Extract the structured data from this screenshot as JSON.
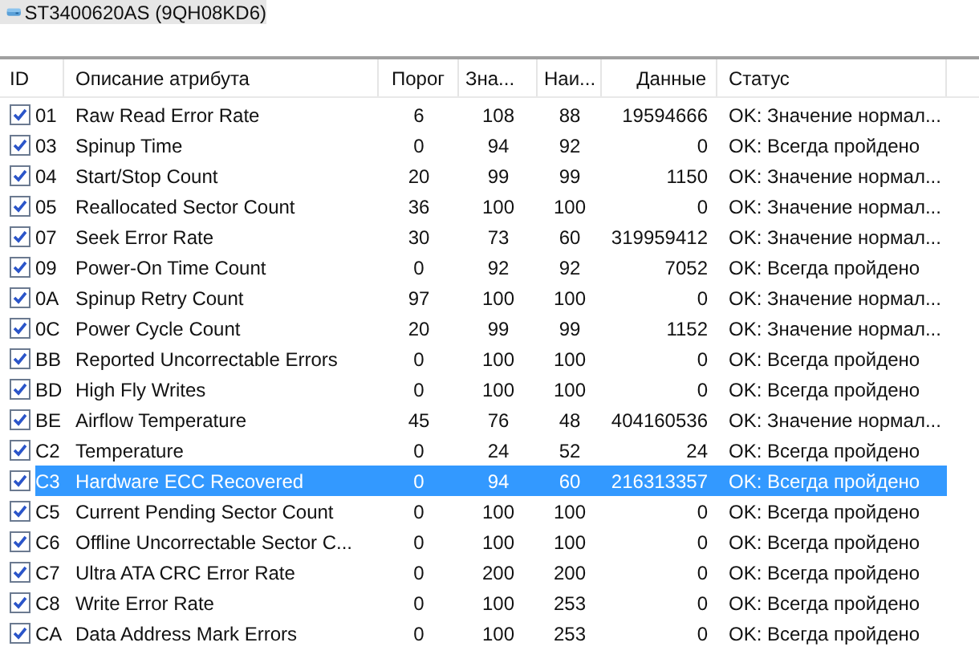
{
  "drive": {
    "title": "ST3400620AS (9QH08KD6)"
  },
  "table": {
    "columns": [
      "ID",
      "Описание атрибута",
      "Порог",
      "Зна...",
      "Наи...",
      "Данные",
      "Статус"
    ],
    "rows": [
      {
        "checked": true,
        "selected": false,
        "cells": [
          "01",
          "Raw Read Error Rate",
          "6",
          "108",
          "88",
          "19594666",
          "OK: Значение нормал..."
        ]
      },
      {
        "checked": true,
        "selected": false,
        "cells": [
          "03",
          "Spinup Time",
          "0",
          "94",
          "92",
          "0",
          "OK: Всегда пройдено"
        ]
      },
      {
        "checked": true,
        "selected": false,
        "cells": [
          "04",
          "Start/Stop Count",
          "20",
          "99",
          "99",
          "1150",
          "OK: Значение нормал..."
        ]
      },
      {
        "checked": true,
        "selected": false,
        "cells": [
          "05",
          "Reallocated Sector Count",
          "36",
          "100",
          "100",
          "0",
          "OK: Значение нормал..."
        ]
      },
      {
        "checked": true,
        "selected": false,
        "cells": [
          "07",
          "Seek Error Rate",
          "30",
          "73",
          "60",
          "319959412",
          "OK: Значение нормал..."
        ]
      },
      {
        "checked": true,
        "selected": false,
        "cells": [
          "09",
          "Power-On Time Count",
          "0",
          "92",
          "92",
          "7052",
          "OK: Всегда пройдено"
        ]
      },
      {
        "checked": true,
        "selected": false,
        "cells": [
          "0A",
          "Spinup Retry Count",
          "97",
          "100",
          "100",
          "0",
          "OK: Значение нормал..."
        ]
      },
      {
        "checked": true,
        "selected": false,
        "cells": [
          "0C",
          "Power Cycle Count",
          "20",
          "99",
          "99",
          "1152",
          "OK: Значение нормал..."
        ]
      },
      {
        "checked": true,
        "selected": false,
        "cells": [
          "BB",
          "Reported Uncorrectable Errors",
          "0",
          "100",
          "100",
          "0",
          "OK: Всегда пройдено"
        ]
      },
      {
        "checked": true,
        "selected": false,
        "cells": [
          "BD",
          "High Fly Writes",
          "0",
          "100",
          "100",
          "0",
          "OK: Всегда пройдено"
        ]
      },
      {
        "checked": true,
        "selected": false,
        "cells": [
          "BE",
          "Airflow Temperature",
          "45",
          "76",
          "48",
          "404160536",
          "OK: Значение нормал..."
        ]
      },
      {
        "checked": true,
        "selected": false,
        "cells": [
          "C2",
          "Temperature",
          "0",
          "24",
          "52",
          "24",
          "OK: Всегда пройдено"
        ]
      },
      {
        "checked": true,
        "selected": true,
        "cells": [
          "C3",
          "Hardware ECC Recovered",
          "0",
          "94",
          "60",
          "216313357",
          "OK: Всегда пройдено"
        ]
      },
      {
        "checked": true,
        "selected": false,
        "cells": [
          "C5",
          "Current Pending Sector Count",
          "0",
          "100",
          "100",
          "0",
          "OK: Всегда пройдено"
        ]
      },
      {
        "checked": true,
        "selected": false,
        "cells": [
          "C6",
          "Offline Uncorrectable Sector C...",
          "0",
          "100",
          "100",
          "0",
          "OK: Всегда пройдено"
        ]
      },
      {
        "checked": true,
        "selected": false,
        "cells": [
          "C7",
          "Ultra ATA CRC Error Rate",
          "0",
          "200",
          "200",
          "0",
          "OK: Всегда пройдено"
        ]
      },
      {
        "checked": true,
        "selected": false,
        "cells": [
          "C8",
          "Write Error Rate",
          "0",
          "100",
          "253",
          "0",
          "OK: Всегда пройдено"
        ]
      },
      {
        "checked": true,
        "selected": false,
        "cells": [
          "CA",
          "Data Address Mark Errors",
          "0",
          "100",
          "253",
          "0",
          "OK: Всегда пройдено"
        ]
      }
    ]
  }
}
